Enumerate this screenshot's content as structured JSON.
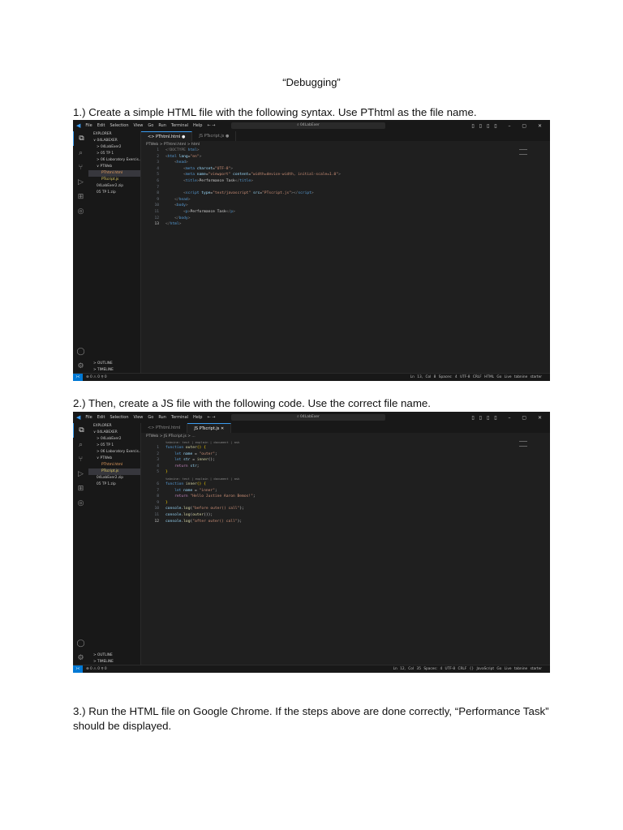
{
  "doc": {
    "title": "“Debugging”",
    "step1": "1.) Create a simple HTML file with the following syntax. Use PThtml as the file name.",
    "step2": "2.) Then, create a JS file with the following code. Use the correct file name.",
    "step3": "3.) Run the HTML file on Google Chrome. If the steps above are done correctly, “Performance Task” should be displayed."
  },
  "menu": [
    "File",
    "Edit",
    "Selection",
    "View",
    "Go",
    "Run",
    "Terminal",
    "Help"
  ],
  "search": "04LabExer",
  "explorer": {
    "header": "EXPLORER",
    "root": "04LABEXER",
    "items": [
      "> 04LabExer2",
      "> 05 TP 1",
      "> 06 Laboratory Exercis...",
      "∨ PTWeb",
      "PThtml.html",
      "PTscript.js",
      "04LabExer2.zip",
      "05 TP 1.zip"
    ],
    "outline": "> OUTLINE",
    "timeline": "> TIMELINE"
  },
  "editors": [
    {
      "tabs": [
        "PThtml.html ●",
        "PTscript.js ●"
      ],
      "breadcrumb": "PTWeb > PThtml.html > html",
      "lines": [
        [
          [
            "<!DOCTYPE ",
            "t-p"
          ],
          [
            "html",
            "t-tag"
          ],
          [
            ">",
            "t-p"
          ]
        ],
        [
          [
            "<",
            "t-p"
          ],
          [
            "html ",
            "t-tag"
          ],
          [
            "lang",
            "t-at"
          ],
          [
            "=",
            "t-x"
          ],
          [
            "\"en\"",
            "t-s"
          ],
          [
            ">",
            "t-p"
          ]
        ],
        [
          [
            "    <",
            "t-p"
          ],
          [
            "head",
            "t-tag"
          ],
          [
            ">",
            "t-p"
          ]
        ],
        [
          [
            "        <",
            "t-p"
          ],
          [
            "meta ",
            "t-tag"
          ],
          [
            "charset",
            "t-at"
          ],
          [
            "=",
            "t-x"
          ],
          [
            "\"UTF-8\"",
            "t-s"
          ],
          [
            ">",
            "t-p"
          ]
        ],
        [
          [
            "        <",
            "t-p"
          ],
          [
            "meta ",
            "t-tag"
          ],
          [
            "name",
            "t-at"
          ],
          [
            "=",
            "t-x"
          ],
          [
            "\"viewport\" ",
            "t-s"
          ],
          [
            "content",
            "t-at"
          ],
          [
            "=",
            "t-x"
          ],
          [
            "\"width=device-width, initial-scale=1.0\"",
            "t-s"
          ],
          [
            ">",
            "t-p"
          ]
        ],
        [
          [
            "        <",
            "t-p"
          ],
          [
            "title",
            "t-tag"
          ],
          [
            ">",
            "t-p"
          ],
          [
            "Performance Task",
            "t-x"
          ],
          [
            "</",
            "t-p"
          ],
          [
            "title",
            "t-tag"
          ],
          [
            ">",
            "t-p"
          ]
        ],
        [
          [
            "",
            "t-x"
          ]
        ],
        [
          [
            "        <",
            "t-p"
          ],
          [
            "script ",
            "t-tag"
          ],
          [
            "type",
            "t-at"
          ],
          [
            "=",
            "t-x"
          ],
          [
            "\"text/javascript\" ",
            "t-s"
          ],
          [
            "src",
            "t-at"
          ],
          [
            "=",
            "t-x"
          ],
          [
            "\"PTscript.js\"",
            "t-s"
          ],
          [
            "></",
            "t-p"
          ],
          [
            "script",
            "t-tag"
          ],
          [
            ">",
            "t-p"
          ]
        ],
        [
          [
            "    </",
            "t-p"
          ],
          [
            "head",
            "t-tag"
          ],
          [
            ">",
            "t-p"
          ]
        ],
        [
          [
            "    <",
            "t-p"
          ],
          [
            "body",
            "t-tag"
          ],
          [
            ">",
            "t-p"
          ]
        ],
        [
          [
            "        <",
            "t-p"
          ],
          [
            "p",
            "t-tag"
          ],
          [
            ">",
            "t-p"
          ],
          [
            "Performance Task",
            "t-x"
          ],
          [
            "</",
            "t-p"
          ],
          [
            "p",
            "t-tag"
          ],
          [
            ">",
            "t-p"
          ]
        ],
        [
          [
            "    </",
            "t-p"
          ],
          [
            "body",
            "t-tag"
          ],
          [
            ">",
            "t-p"
          ]
        ],
        [
          [
            "</",
            "t-p"
          ],
          [
            "html",
            "t-tag"
          ],
          [
            ">",
            "t-p"
          ]
        ]
      ],
      "status": {
        "left": "⊗ 0 ⚠ 0   ⚲ 0",
        "right": "Ln 13, Col 8   Spaces: 4   UTF-8   CRLF   HTML   Go Live   tabnine starter"
      }
    },
    {
      "tabs": [
        "PThtml.html",
        "PTscript.js ✕"
      ],
      "breadcrumb": "PTWeb > JS PTscript.js > ...",
      "lens": "tabnine: test | explain | document | ask",
      "lines": [
        [
          [
            "function ",
            "t-kw"
          ],
          [
            "outer",
            "t-fn"
          ],
          [
            "() ",
            "t-b"
          ],
          [
            "{",
            "t-b"
          ]
        ],
        [
          [
            "    let ",
            "t-kw"
          ],
          [
            "name",
            "t-v"
          ],
          [
            " = ",
            "t-x"
          ],
          [
            "\"outer\"",
            "t-s"
          ],
          [
            ";",
            "t-x"
          ]
        ],
        [
          [
            "    let ",
            "t-kw"
          ],
          [
            "str",
            "t-v"
          ],
          [
            " = ",
            "t-x"
          ],
          [
            "inner",
            "t-fn"
          ],
          [
            "();",
            "t-x"
          ]
        ],
        [
          [
            "    return ",
            "t-cf"
          ],
          [
            "str",
            "t-v"
          ],
          [
            ";",
            "t-x"
          ]
        ],
        [
          [
            "}",
            "t-b"
          ]
        ],
        [
          [
            "function ",
            "t-kw"
          ],
          [
            "inner",
            "t-fn"
          ],
          [
            "() ",
            "t-b"
          ],
          [
            "{",
            "t-b"
          ]
        ],
        [
          [
            "    let ",
            "t-kw"
          ],
          [
            "name",
            "t-v"
          ],
          [
            " = ",
            "t-x"
          ],
          [
            "\"inner\"",
            "t-s"
          ],
          [
            ";",
            "t-x"
          ]
        ],
        [
          [
            "    return ",
            "t-cf"
          ],
          [
            "\"Hello Justine Aaron Bemos!\"",
            "t-s"
          ],
          [
            ";",
            "t-x"
          ]
        ],
        [
          [
            "}",
            "t-b"
          ]
        ],
        [
          [
            "console",
            "t-v"
          ],
          [
            ".",
            "t-x"
          ],
          [
            "log",
            "t-fn"
          ],
          [
            "(",
            "t-x"
          ],
          [
            "\"before outer() call\"",
            "t-s"
          ],
          [
            ");",
            "t-x"
          ]
        ],
        [
          [
            "console",
            "t-v"
          ],
          [
            ".",
            "t-x"
          ],
          [
            "log",
            "t-fn"
          ],
          [
            "(",
            "t-x"
          ],
          [
            "outer",
            "t-fn"
          ],
          [
            "());",
            "t-x"
          ]
        ],
        [
          [
            "console",
            "t-v"
          ],
          [
            ".",
            "t-x"
          ],
          [
            "log",
            "t-fn"
          ],
          [
            "(",
            "t-x"
          ],
          [
            "\"after outer() call\"",
            "t-s"
          ],
          [
            ");",
            "t-x"
          ]
        ]
      ],
      "lensBefore": [
        0,
        5
      ],
      "status": {
        "left": "⊗ 0 ⚠ 0   ⚲ 0",
        "right": "Ln 12, Col 35   Spaces: 4   UTF-8   CRLF   {} JavaScript   Go Live   tabnine starter"
      }
    }
  ]
}
